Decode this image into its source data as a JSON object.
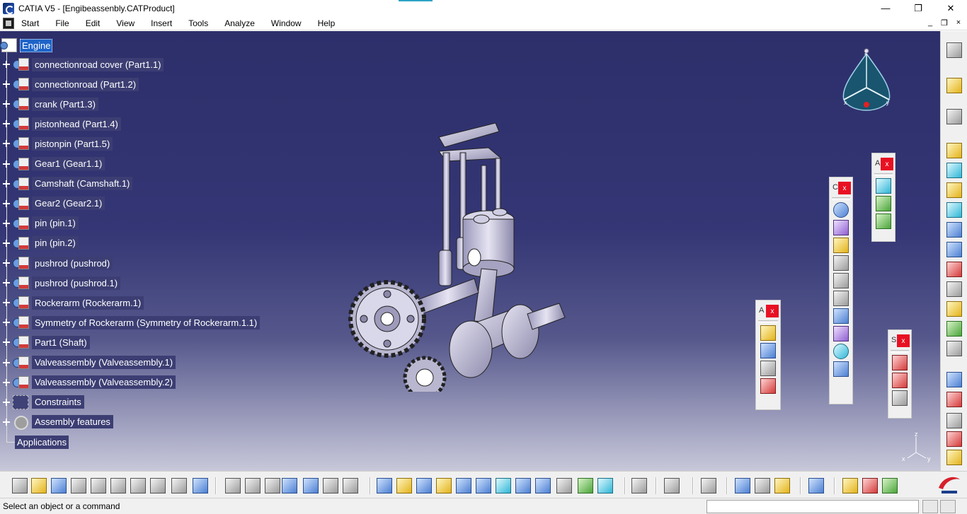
{
  "window": {
    "title": "CATIA V5 - [Engibeassenbly.CATProduct]",
    "minimize": "—",
    "maximize": "❐",
    "close": "✕"
  },
  "menu": {
    "items": [
      "Start",
      "File",
      "Edit",
      "View",
      "Insert",
      "Tools",
      "Analyze",
      "Window",
      "Help"
    ],
    "mdi_min": "_",
    "mdi_restore": "❐",
    "mdi_close": "×"
  },
  "tree": {
    "root": "Engine",
    "items": [
      "connectionroad cover (Part1.1)",
      "connectionroad (Part1.2)",
      "crank (Part1.3)",
      "pistonhead (Part1.4)",
      "pistonpin (Part1.5)",
      "Gear1 (Gear1.1)",
      "Camshaft (Camshaft.1)",
      "Gear2 (Gear2.1)",
      "pin (pin.1)",
      "pin (pin.2)",
      "pushrod (pushrod)",
      "pushrod (pushrod.1)",
      "Rockerarm (Rockerarm.1)",
      "Symmetry of Rockerarm (Symmetry of Rockerarm.1.1)",
      "Part1 (Shaft)",
      "Valveassembly (Valveassembly.1)",
      "Valveassembly (Valveassembly.2)",
      "Constraints",
      "Assembly features"
    ],
    "applications": "Applications"
  },
  "compass": {
    "z": "z",
    "x": "x",
    "y": "y"
  },
  "axis_triad": {
    "z": "z",
    "x": "x",
    "y": "y"
  },
  "float_toolbars": {
    "a1_title": "A",
    "c_title": "C",
    "a2_title": "A",
    "s_title": "S",
    "close": "x"
  },
  "status": {
    "text": "Select an object or a command",
    "command_input": ""
  },
  "colors": {
    "selection": "#1e64c8",
    "tree_label_bg": "#3c3e73",
    "workspace_top": "#2d2f6b",
    "close_red": "#e81123"
  }
}
